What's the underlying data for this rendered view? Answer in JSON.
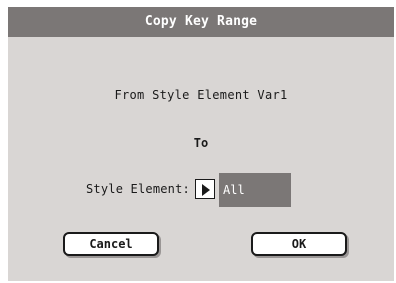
{
  "dialog": {
    "title": "Copy Key Range",
    "from_text": "From Style Element Var1",
    "to_text": "To",
    "style_element": {
      "label": "Style Element:",
      "selected_value": "All"
    },
    "buttons": {
      "cancel_label": "Cancel",
      "ok_label": "OK"
    }
  },
  "colors": {
    "title_bar": "#7b7776",
    "dialog_background": "#d9d6d4",
    "value_field": "#7b7776"
  },
  "icons": {
    "dropdown": "triangle-right-icon"
  }
}
